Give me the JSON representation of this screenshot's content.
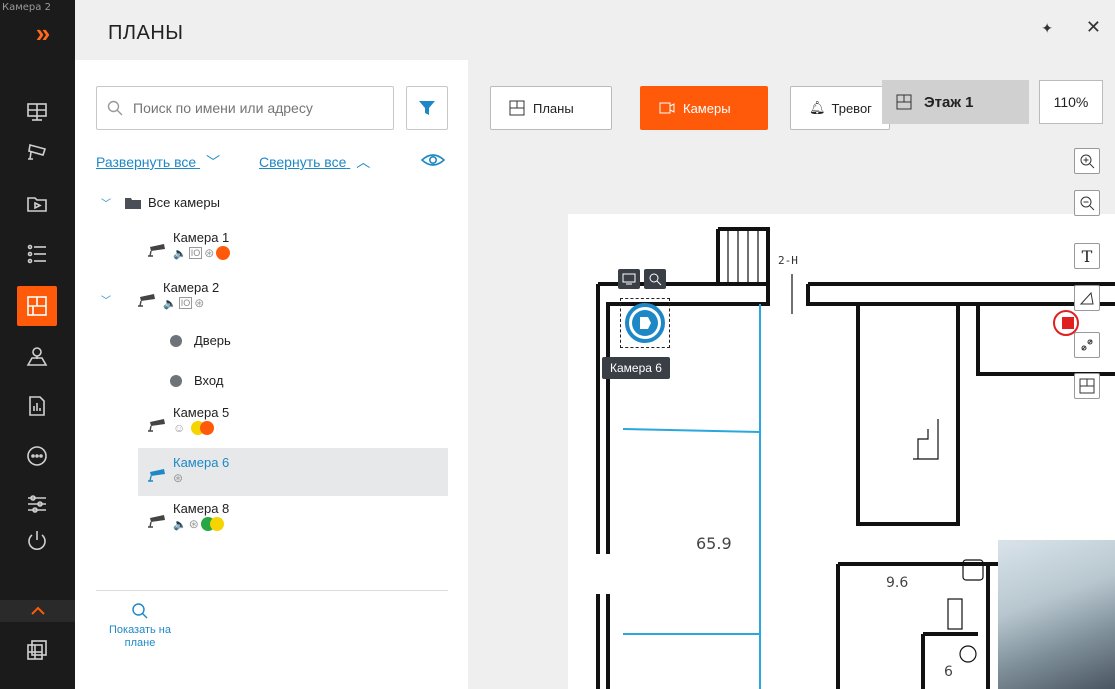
{
  "rail": {
    "window_title": "Камера 2"
  },
  "header": {
    "title": "ПЛАНЫ"
  },
  "search": {
    "placeholder": "Поиск по имени или адресу"
  },
  "links": {
    "expand_all": "Развернуть все",
    "collapse_all": "Свернуть все"
  },
  "tree": {
    "root": "Все камеры",
    "cameras": [
      {
        "name": "Камера 1",
        "status_colors": [
          "#ff5a0a"
        ]
      },
      {
        "name": "Камера 2",
        "children": [
          "Дверь",
          "Вход"
        ]
      },
      {
        "name": "Камера 5",
        "status_colors": [
          "#f5d400",
          "#ff5a0a"
        ]
      },
      {
        "name": "Камера 6",
        "selected": true
      },
      {
        "name": "Камера 8",
        "status_colors": [
          "#28a745",
          "#f5d400"
        ]
      }
    ]
  },
  "bottom": {
    "show_on_plan": "Показать на плане"
  },
  "toolbar": {
    "plans": "Планы",
    "cameras": "Камеры",
    "alarms": "Тревог",
    "floor": "Этаж 1",
    "zoom": "110%"
  },
  "map": {
    "camera_tooltip": "Камера 6",
    "labels": {
      "stairs": "2-Н",
      "area1": "65.9",
      "area2": "9.6",
      "area3": "6"
    }
  },
  "colors": {
    "accent": "#ff5a0a",
    "link": "#1e88c6",
    "selected_camera": "#1e88c6"
  }
}
